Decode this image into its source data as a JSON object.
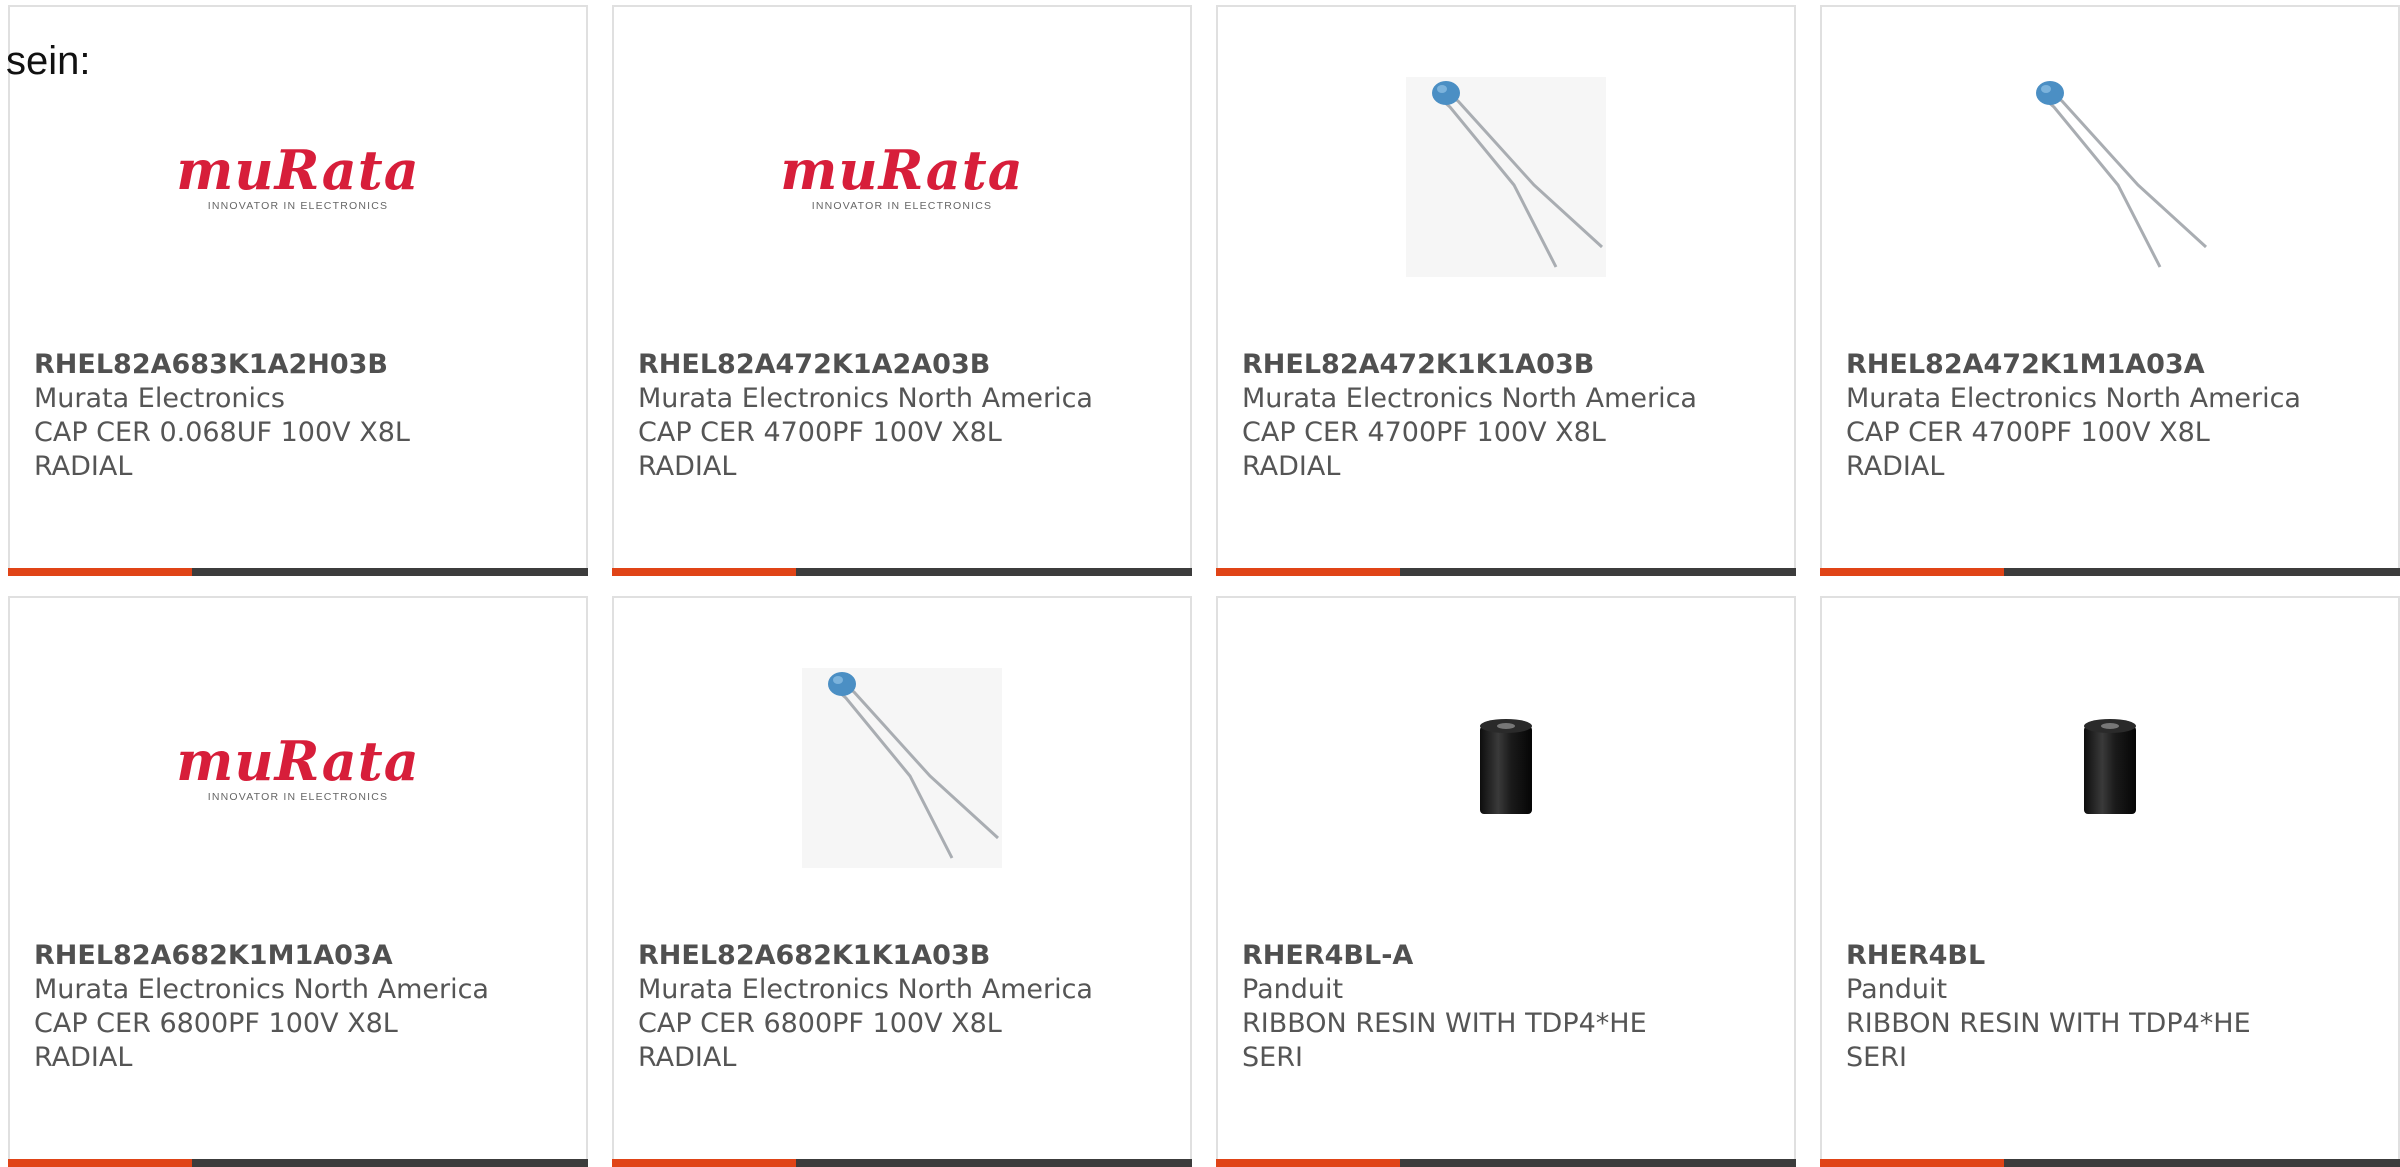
{
  "intro_text": "sein:",
  "brand_colors": {
    "accent_bar": "#e04417",
    "dark_bar": "#3c3c3c",
    "logo_red": "#d71e3a"
  },
  "logo": {
    "word": "muRata",
    "tagline": "INNOVATOR IN ELECTRONICS"
  },
  "products": [
    {
      "part_number": "RHEL82A683K1A2H03B",
      "manufacturer": "Murata Electronics",
      "description_line1": "CAP CER 0.068UF 100V X8L",
      "description_line2": "RADIAL",
      "image": "murata-logo"
    },
    {
      "part_number": "RHEL82A472K1A2A03B",
      "manufacturer": "Murata Electronics North America",
      "description_line1": "CAP CER 4700PF 100V X8L",
      "description_line2": "RADIAL",
      "image": "murata-logo"
    },
    {
      "part_number": "RHEL82A472K1K1A03B",
      "manufacturer": "Murata Electronics North America",
      "description_line1": "CAP CER 4700PF 100V X8L",
      "description_line2": "RADIAL",
      "image": "ceramic-capacitor-icon"
    },
    {
      "part_number": "RHEL82A472K1M1A03A",
      "manufacturer": "Murata Electronics North America",
      "description_line1": "CAP CER 4700PF 100V X8L",
      "description_line2": "RADIAL",
      "image": "ceramic-capacitor-icon"
    },
    {
      "part_number": "RHEL82A682K1M1A03A",
      "manufacturer": "Murata Electronics North America",
      "description_line1": "CAP CER 6800PF 100V X8L",
      "description_line2": "RADIAL",
      "image": "murata-logo"
    },
    {
      "part_number": "RHEL82A682K1K1A03B",
      "manufacturer": "Murata Electronics North America",
      "description_line1": "CAP CER 6800PF 100V X8L",
      "description_line2": "RADIAL",
      "image": "ceramic-capacitor-icon"
    },
    {
      "part_number": "RHER4BL-A",
      "manufacturer": "Panduit",
      "description_line1": "RIBBON RESIN WITH TDP4*HE",
      "description_line2": "SERI",
      "image": "ribbon-roll-icon"
    },
    {
      "part_number": "RHER4BL",
      "manufacturer": "Panduit",
      "description_line1": "RIBBON RESIN WITH TDP4*HE",
      "description_line2": "SERI",
      "image": "ribbon-roll-icon"
    }
  ]
}
